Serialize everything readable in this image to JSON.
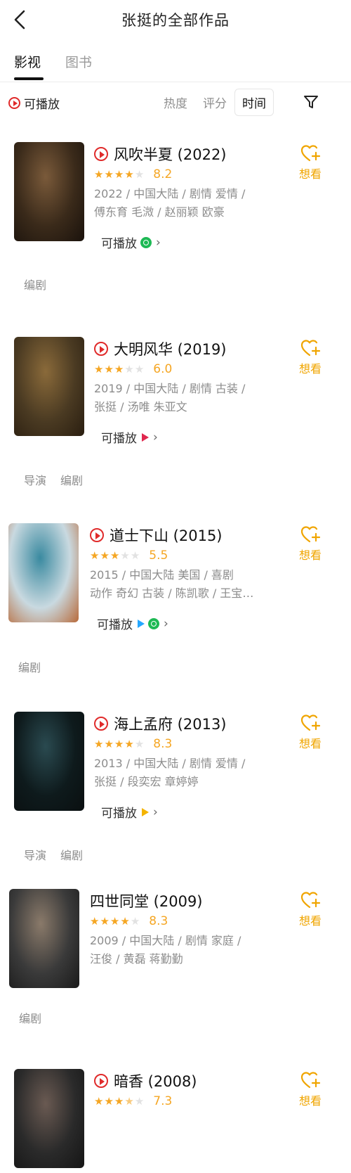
{
  "header": {
    "title": "张挺的全部作品"
  },
  "tabs": [
    {
      "label": "影视"
    },
    {
      "label": "图书"
    }
  ],
  "filter": {
    "playable_label": "可播放",
    "sort_options": [
      "热度",
      "评分",
      "时间"
    ],
    "selected_sort": "时间"
  },
  "colors": {
    "accent": "#f5a623",
    "play_red": "#e02b2b",
    "want_gold": "#f0a500"
  },
  "works": [
    {
      "title": "风吹半夏 (2022)",
      "has_play": true,
      "stars": 4,
      "rating": "8.2",
      "meta_line1": "2022 / 中国大陆 / 剧情 爱情 /",
      "meta_line2": "傅东育 毛溦 / 赵丽颖 欧豪",
      "playable_text": "可播放",
      "sources": [
        "green"
      ],
      "want_label": "想看",
      "roles": [
        "编剧"
      ],
      "poster_colors": [
        "#3a2a1a",
        "#7a5a3a",
        "#1a120c"
      ]
    },
    {
      "title": "大明风华 (2019)",
      "has_play": true,
      "stars": 3,
      "rating": "6.0",
      "meta_line1": "2019 / 中国大陆 / 剧情 古装 /",
      "meta_line2": "张挺 / 汤唯 朱亚文",
      "playable_text": "可播放",
      "sources": [
        "multi"
      ],
      "want_label": "想看",
      "roles": [
        "导演",
        "编剧"
      ],
      "poster_colors": [
        "#4a3a22",
        "#8a6a3a",
        "#2a1e10"
      ]
    },
    {
      "title": "道士下山 (2015)",
      "has_play": true,
      "stars": 3,
      "rating": "5.5",
      "meta_line1": "2015 / 中国大陆 美国 / 喜剧",
      "meta_line2": "动作 奇幻 古装 / 陈凯歌 / 王宝强 郭富城 林志玲 范伟",
      "playable_text": "可播放",
      "sources": [
        "blue",
        "green"
      ],
      "want_label": "想看",
      "roles": [
        "编剧"
      ],
      "poster_colors": [
        "#c9d9e0",
        "#3a8aa0",
        "#b86a3a"
      ]
    },
    {
      "title": "海上孟府 (2013)",
      "has_play": true,
      "stars": 4,
      "rating": "8.3",
      "meta_line1": "2013 / 中国大陆 / 剧情 爱情 /",
      "meta_line2": "张挺 / 段奕宏 章婷婷",
      "playable_text": "可播放",
      "sources": [
        "yellow"
      ],
      "want_label": "想看",
      "roles": [
        "导演",
        "编剧"
      ],
      "poster_colors": [
        "#0e1a1c",
        "#2a4a50",
        "#0a0f10"
      ]
    },
    {
      "title": "四世同堂 (2009)",
      "has_play": false,
      "stars": 4,
      "rating": "8.3",
      "meta_line1": "2009 / 中国大陆 / 剧情 家庭 /",
      "meta_line2": "汪俊 / 黄磊 蒋勤勤",
      "playable_text": "",
      "sources": [],
      "want_label": "想看",
      "roles": [
        "编剧"
      ],
      "poster_colors": [
        "#3a3a3a",
        "#8a7a6a",
        "#1a1a1a"
      ]
    },
    {
      "title": "暗香 (2008)",
      "has_play": true,
      "stars": 3.5,
      "rating": "7.3",
      "meta_line1": "",
      "meta_line2": "",
      "playable_text": "",
      "sources": [],
      "want_label": "想看",
      "roles": [],
      "poster_colors": [
        "#2a2a2a",
        "#6a5a52",
        "#151515"
      ]
    }
  ]
}
